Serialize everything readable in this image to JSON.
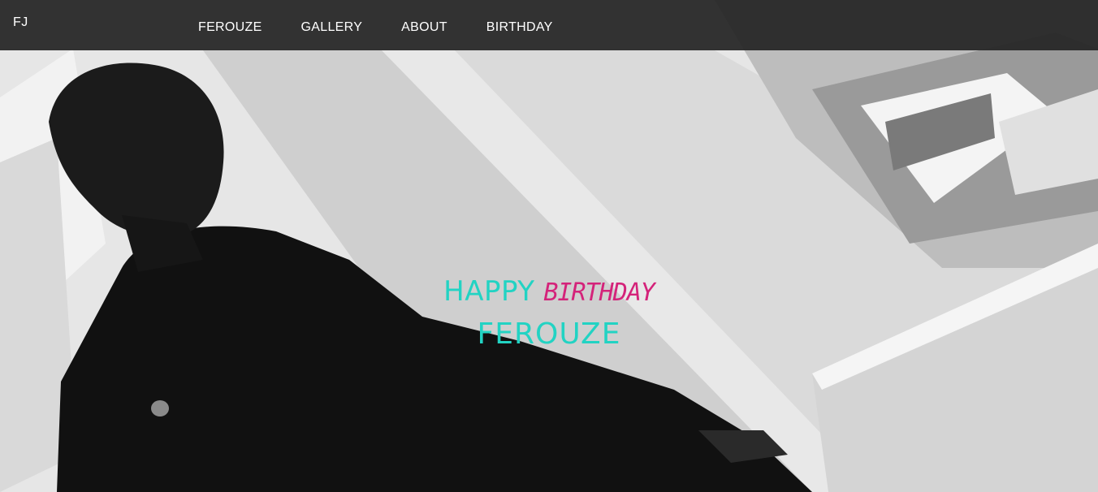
{
  "brand": {
    "label": "FJ"
  },
  "nav": {
    "items": [
      {
        "label": "FEROUZE"
      },
      {
        "label": "GALLERY"
      },
      {
        "label": "ABOUT"
      },
      {
        "label": "BIRTHDAY"
      }
    ]
  },
  "hero": {
    "greeting_word": "HAPPY",
    "occasion_word": "BIRTHDAY",
    "name": "FEROUZE",
    "image": {
      "description": "Black and white photo of a man seated near a white concrete pillar",
      "type": "photograph"
    }
  },
  "colors": {
    "navbar_bg": "#262626",
    "nav_text": "#ffffff",
    "accent_teal": "#22d3c3",
    "accent_pink": "#d4237a"
  }
}
